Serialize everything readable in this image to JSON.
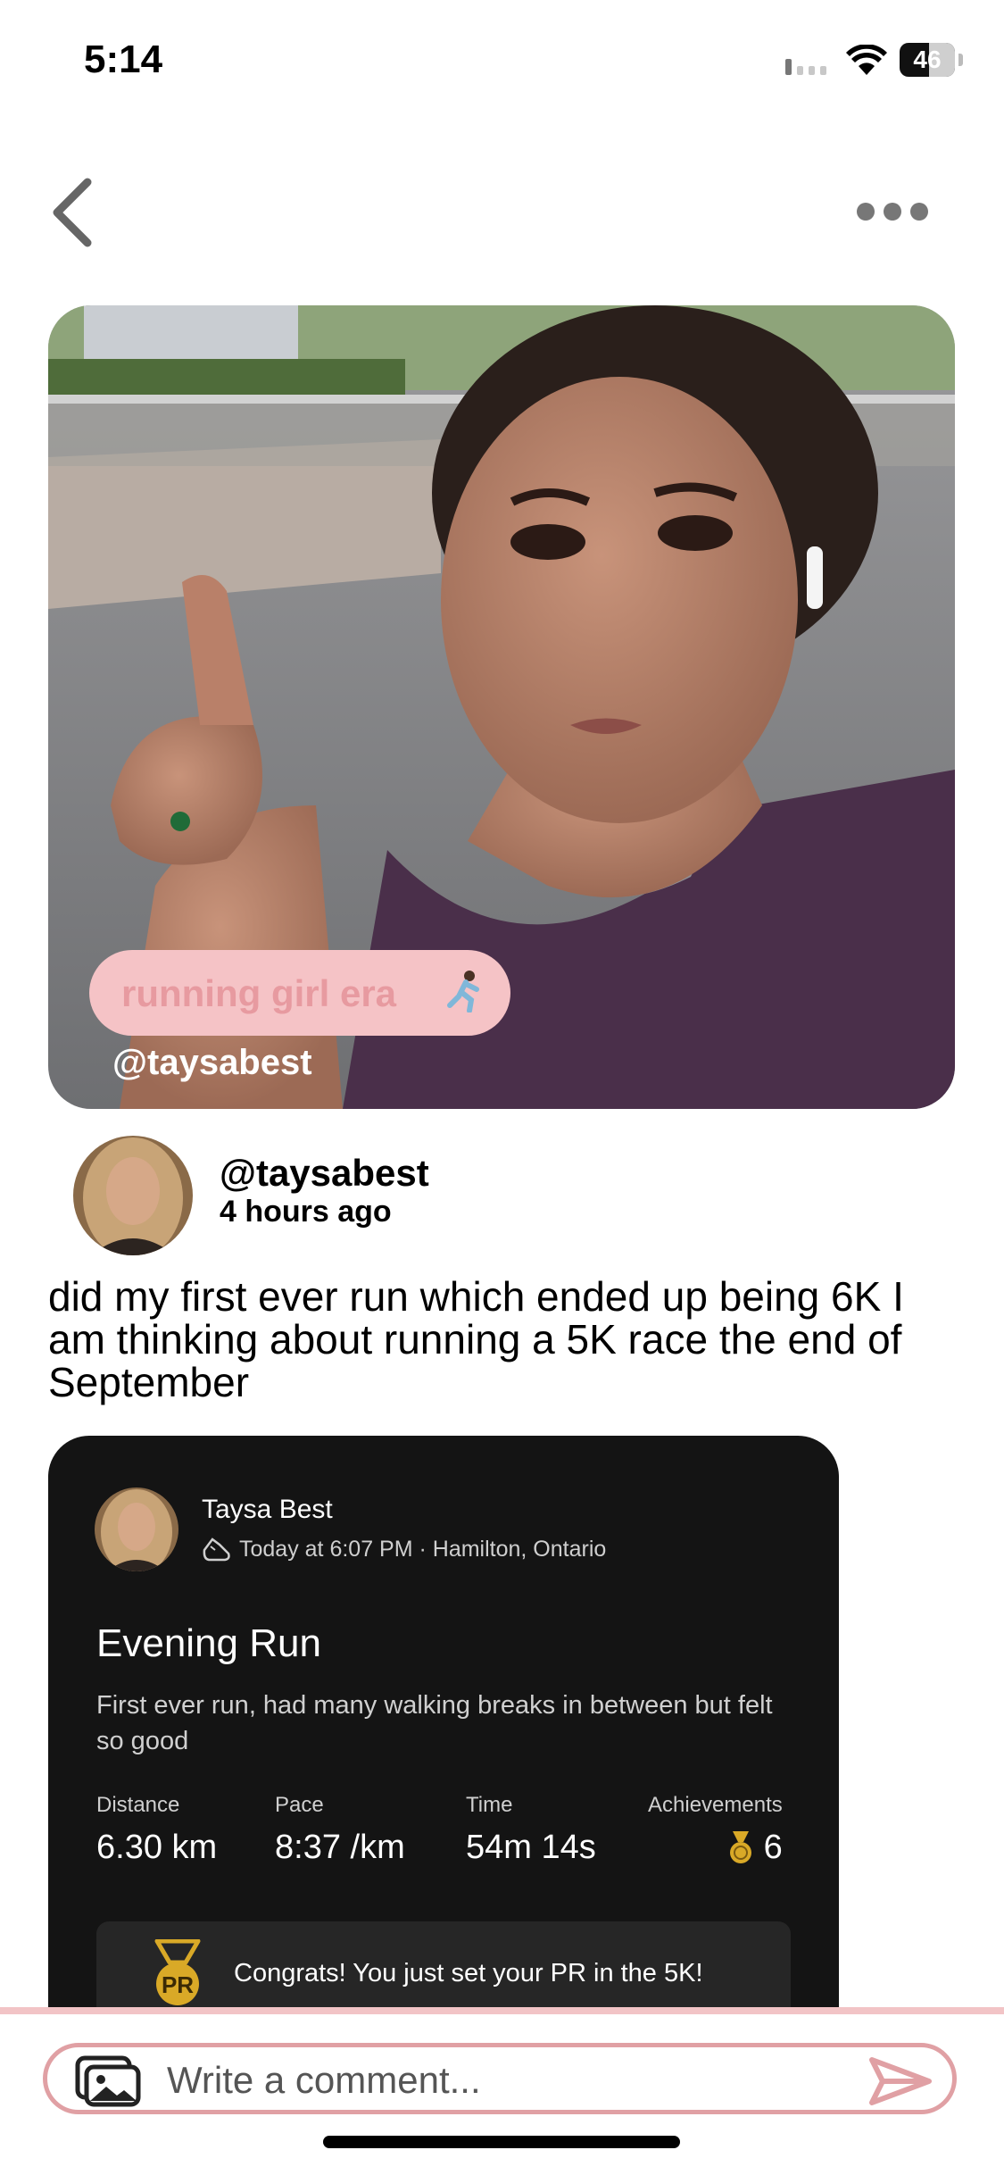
{
  "status_bar": {
    "time": "5:14",
    "battery": "46"
  },
  "nav": {
    "back_icon": "chevron-left-icon",
    "more_icon": "ellipsis-icon"
  },
  "photo": {
    "sticker_text": "running girl era",
    "watermark": "@taysabest"
  },
  "post": {
    "username": "@taysabest",
    "time_ago": "4 hours ago",
    "caption": "did my first ever run which ended up being 6K I am thinking about running a 5K race the end of September"
  },
  "run_card": {
    "athlete_name": "Taysa Best",
    "meta": "Today at 6:07 PM · Hamilton, Ontario",
    "title": "Evening Run",
    "description": "First ever run, had many walking breaks in between but felt so good",
    "stats": [
      {
        "label": "Distance",
        "value": "6.30 km"
      },
      {
        "label": "Pace",
        "value": "8:37 /km"
      },
      {
        "label": "Time",
        "value": "54m 14s"
      },
      {
        "label": "Achievements",
        "value": "6"
      }
    ],
    "pr_badge": "PR",
    "pr_text": "Congrats! You just set your PR in the 5K!"
  },
  "comment": {
    "placeholder": "Write a comment..."
  },
  "colors": {
    "accent_pink": "#e0a0a4",
    "card_bg": "#141414",
    "medal_gold": "#d9a927"
  }
}
